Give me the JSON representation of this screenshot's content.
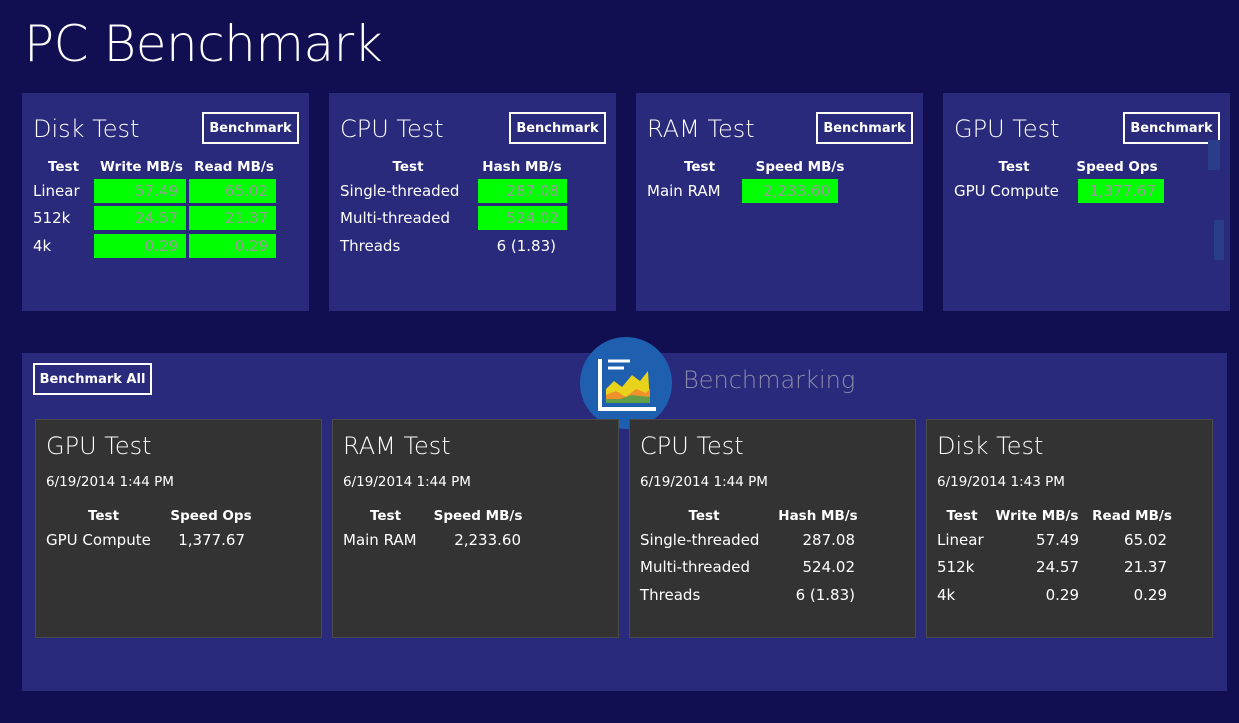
{
  "app": {
    "title": "PC Benchmark"
  },
  "tiles": {
    "disk": {
      "title": "Disk Test",
      "button": "Benchmark",
      "headers": [
        "Test",
        "Write MB/s",
        "Read MB/s"
      ],
      "rows": [
        {
          "test": "Linear",
          "write": "57.49",
          "read": "65.02"
        },
        {
          "test": "512k",
          "write": "24.57",
          "read": "21.37"
        },
        {
          "test": "4k",
          "write": "0.29",
          "read": "0.29"
        }
      ]
    },
    "cpu": {
      "title": "CPU Test",
      "button": "Benchmark",
      "headers": [
        "Test",
        "Hash MB/s"
      ],
      "rows": [
        {
          "test": "Single-threaded",
          "value": "287.08"
        },
        {
          "test": "Multi-threaded",
          "value": "524.02"
        },
        {
          "test": "Threads",
          "value": "6 (1.83)"
        }
      ]
    },
    "ram": {
      "title": "RAM Test",
      "button": "Benchmark",
      "headers": [
        "Test",
        "Speed MB/s"
      ],
      "rows": [
        {
          "test": "Main RAM",
          "value": "2,233.60"
        }
      ]
    },
    "gpu": {
      "title": "GPU Test",
      "button": "Benchmark",
      "headers": [
        "Test",
        "Speed Ops"
      ],
      "rows": [
        {
          "test": "GPU Compute",
          "value": "1,377.67"
        }
      ]
    }
  },
  "panel": {
    "button": "Benchmark All",
    "status": "Benchmarking",
    "colors": {
      "accent": "#00ff00",
      "tile": "#2a2a7c",
      "card": "#333333",
      "background": "#110e52",
      "logo": "#1e5fb0"
    },
    "icons": {
      "logo": "benchmark-chart-icon"
    },
    "results": {
      "gpu": {
        "title": "GPU Test",
        "date": "6/19/2014 1:44 PM",
        "headers": [
          "Test",
          "Speed Ops"
        ],
        "rows": [
          {
            "test": "GPU Compute",
            "value": "1,377.67"
          }
        ]
      },
      "ram": {
        "title": "RAM Test",
        "date": "6/19/2014 1:44 PM",
        "headers": [
          "Test",
          "Speed MB/s"
        ],
        "rows": [
          {
            "test": "Main RAM",
            "value": "2,233.60"
          }
        ]
      },
      "cpu": {
        "title": "CPU Test",
        "date": "6/19/2014 1:44 PM",
        "headers": [
          "Test",
          "Hash MB/s"
        ],
        "rows": [
          {
            "test": "Single-threaded",
            "value": "287.08"
          },
          {
            "test": "Multi-threaded",
            "value": "524.02"
          },
          {
            "test": "Threads",
            "value": "6 (1.83)"
          }
        ]
      },
      "disk": {
        "title": "Disk Test",
        "date": "6/19/2014 1:43 PM",
        "headers": [
          "Test",
          "Write MB/s",
          "Read MB/s"
        ],
        "rows": [
          {
            "test": "Linear",
            "write": "57.49",
            "read": "65.02"
          },
          {
            "test": "512k",
            "write": "24.57",
            "read": "21.37"
          },
          {
            "test": "4k",
            "write": "0.29",
            "read": "0.29"
          }
        ]
      }
    }
  }
}
